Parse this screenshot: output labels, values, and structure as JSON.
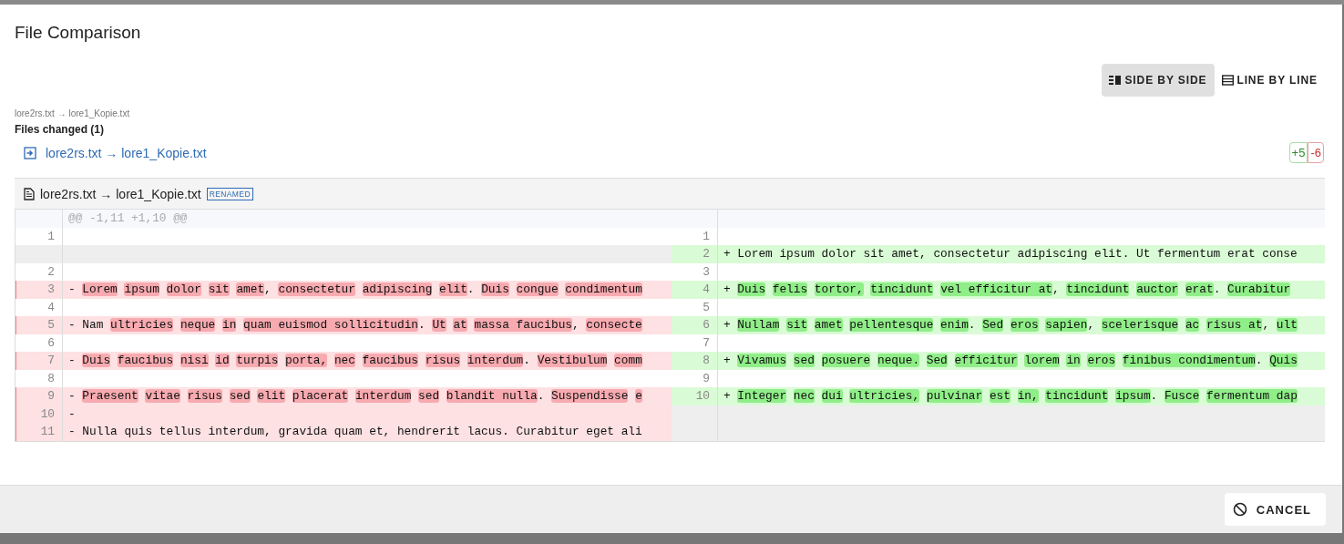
{
  "dialog": {
    "title": "File Comparison"
  },
  "view_modes": [
    {
      "label": "SIDE BY SIDE",
      "kind": "side",
      "selected": true
    },
    {
      "label": "LINE BY LINE",
      "kind": "line",
      "selected": false
    }
  ],
  "breadcrumb": "lore2rs.txt → lore1_Kopie.txt",
  "files_changed": {
    "heading": "Files changed (1)",
    "files": [
      {
        "name": "lore2rs.txt → lore1_Kopie.txt",
        "added": "+5",
        "removed": "-6"
      }
    ]
  },
  "file_header": {
    "name": "lore2rs.txt → lore1_Kopie.txt",
    "badge": "RENAMED"
  },
  "hunk": "@@ -1,11 +1,10 @@",
  "rows": [
    {
      "left": {
        "kind": "context",
        "number": "1"
      },
      "right": {
        "kind": "context",
        "number": "1"
      }
    },
    {
      "left": {
        "kind": "empty"
      },
      "right": {
        "kind": "insert",
        "number": "2",
        "sign": "+",
        "segments": [
          {
            "text": "Lorem ipsum dolor sit amet, consectetur adipiscing elit. Ut fermentum erat conse",
            "changed": false
          }
        ]
      }
    },
    {
      "left": {
        "kind": "context",
        "number": "2"
      },
      "right": {
        "kind": "context",
        "number": "3"
      }
    },
    {
      "left": {
        "kind": "delete",
        "number": "3",
        "sign": "-",
        "segments": [
          {
            "text": "Lorem",
            "changed": true
          },
          {
            "text": "ipsum",
            "changed": true
          },
          {
            "text": "dolor",
            "changed": true
          },
          {
            "text": "sit",
            "changed": true
          },
          {
            "text": "amet",
            "changed": true
          },
          {
            "text": ", ",
            "changed": false
          },
          {
            "text": "consectetur",
            "changed": true
          },
          {
            "text": "adipiscing",
            "changed": true
          },
          {
            "text": "elit",
            "changed": true
          },
          {
            "text": ". ",
            "changed": false
          },
          {
            "text": "Duis",
            "changed": true
          },
          {
            "text": "congue",
            "changed": true
          },
          {
            "text": "condimentum",
            "changed": true
          }
        ]
      },
      "right": {
        "kind": "insert",
        "number": "4",
        "sign": "+",
        "segments": [
          {
            "text": "Duis",
            "changed": true
          },
          {
            "text": "felis",
            "changed": true
          },
          {
            "text": "tortor,",
            "changed": true
          },
          {
            "text": "tincidunt",
            "changed": true
          },
          {
            "text": "vel efficitur at",
            "changed": true
          },
          {
            "text": ", ",
            "changed": false
          },
          {
            "text": "tincidunt",
            "changed": true
          },
          {
            "text": "auctor",
            "changed": true
          },
          {
            "text": "erat",
            "changed": true
          },
          {
            "text": ". ",
            "changed": false
          },
          {
            "text": "Curabitur",
            "changed": true
          }
        ]
      }
    },
    {
      "left": {
        "kind": "context",
        "number": "4"
      },
      "right": {
        "kind": "context",
        "number": "5"
      }
    },
    {
      "left": {
        "kind": "delete",
        "number": "5",
        "sign": "-",
        "segments": [
          {
            "text": "Nam ",
            "changed": false
          },
          {
            "text": "ultricies",
            "changed": true
          },
          {
            "text": "neque",
            "changed": true
          },
          {
            "text": "in",
            "changed": true
          },
          {
            "text": "quam euismod sollicitudin",
            "changed": true
          },
          {
            "text": ". ",
            "changed": false
          },
          {
            "text": "Ut",
            "changed": true
          },
          {
            "text": "at",
            "changed": true
          },
          {
            "text": "massa faucibus",
            "changed": true
          },
          {
            "text": ", ",
            "changed": false
          },
          {
            "text": "consecte",
            "changed": true
          }
        ]
      },
      "right": {
        "kind": "insert",
        "number": "6",
        "sign": "+",
        "segments": [
          {
            "text": "Nullam",
            "changed": true
          },
          {
            "text": "sit",
            "changed": true
          },
          {
            "text": "amet",
            "changed": true
          },
          {
            "text": "pellentesque",
            "changed": true
          },
          {
            "text": "enim",
            "changed": true
          },
          {
            "text": ". ",
            "changed": false
          },
          {
            "text": "Sed",
            "changed": true
          },
          {
            "text": "eros",
            "changed": true
          },
          {
            "text": "sapien",
            "changed": true
          },
          {
            "text": ", ",
            "changed": false
          },
          {
            "text": "scelerisque",
            "changed": true
          },
          {
            "text": "ac",
            "changed": true
          },
          {
            "text": "risus at",
            "changed": true
          },
          {
            "text": ", ",
            "changed": false
          },
          {
            "text": "ult",
            "changed": true
          }
        ]
      }
    },
    {
      "left": {
        "kind": "context",
        "number": "6"
      },
      "right": {
        "kind": "context",
        "number": "7"
      }
    },
    {
      "left": {
        "kind": "delete",
        "number": "7",
        "sign": "-",
        "segments": [
          {
            "text": "Duis",
            "changed": true
          },
          {
            "text": "faucibus",
            "changed": true
          },
          {
            "text": "nisi",
            "changed": true
          },
          {
            "text": "id",
            "changed": true
          },
          {
            "text": "turpis",
            "changed": true
          },
          {
            "text": "porta,",
            "changed": true
          },
          {
            "text": "nec",
            "changed": true
          },
          {
            "text": "faucibus",
            "changed": true
          },
          {
            "text": "risus",
            "changed": true
          },
          {
            "text": "interdum",
            "changed": true
          },
          {
            "text": ". ",
            "changed": false
          },
          {
            "text": "Vestibulum",
            "changed": true
          },
          {
            "text": "comm",
            "changed": true
          }
        ]
      },
      "right": {
        "kind": "insert",
        "number": "8",
        "sign": "+",
        "segments": [
          {
            "text": "Vivamus",
            "changed": true
          },
          {
            "text": "sed",
            "changed": true
          },
          {
            "text": "posuere",
            "changed": true
          },
          {
            "text": "neque.",
            "changed": true
          },
          {
            "text": "Sed",
            "changed": true
          },
          {
            "text": "efficitur",
            "changed": true
          },
          {
            "text": "lorem",
            "changed": true
          },
          {
            "text": "in",
            "changed": true
          },
          {
            "text": "eros",
            "changed": true
          },
          {
            "text": "finibus condimentum",
            "changed": true
          },
          {
            "text": ". ",
            "changed": false
          },
          {
            "text": "Quis",
            "changed": true
          }
        ]
      }
    },
    {
      "left": {
        "kind": "context",
        "number": "8"
      },
      "right": {
        "kind": "context",
        "number": "9"
      }
    },
    {
      "left": {
        "kind": "delete",
        "number": "9",
        "sign": "-",
        "segments": [
          {
            "text": "Praesent",
            "changed": true
          },
          {
            "text": "vitae",
            "changed": true
          },
          {
            "text": "risus",
            "changed": true
          },
          {
            "text": "sed",
            "changed": true
          },
          {
            "text": "elit",
            "changed": true
          },
          {
            "text": "placerat",
            "changed": true
          },
          {
            "text": "interdum",
            "changed": true
          },
          {
            "text": "sed",
            "changed": true
          },
          {
            "text": "blandit nulla",
            "changed": true
          },
          {
            "text": ". ",
            "changed": false
          },
          {
            "text": "Suspendisse",
            "changed": true
          },
          {
            "text": "e",
            "changed": true
          }
        ]
      },
      "right": {
        "kind": "insert",
        "number": "10",
        "sign": "+",
        "segments": [
          {
            "text": "Integer",
            "changed": true
          },
          {
            "text": "nec",
            "changed": true
          },
          {
            "text": "dui",
            "changed": true
          },
          {
            "text": "ultricies,",
            "changed": true
          },
          {
            "text": "pulvinar",
            "changed": true
          },
          {
            "text": "est",
            "changed": true
          },
          {
            "text": "in,",
            "changed": true
          },
          {
            "text": "tincidunt",
            "changed": true
          },
          {
            "text": "ipsum",
            "changed": true
          },
          {
            "text": ". ",
            "changed": false
          },
          {
            "text": "Fusce",
            "changed": true
          },
          {
            "text": "fermentum dap",
            "changed": true
          }
        ]
      }
    },
    {
      "left": {
        "kind": "delete",
        "number": "10",
        "sign": "-"
      },
      "right": {
        "kind": "empty"
      }
    },
    {
      "left": {
        "kind": "delete",
        "number": "11",
        "sign": "-",
        "segments": [
          {
            "text": "Nulla quis tellus interdum, gravida quam et, hendrerit lacus. Curabitur eget ali",
            "changed": false
          }
        ]
      },
      "right": {
        "kind": "empty"
      }
    }
  ],
  "footer": {
    "cancel": "CANCEL"
  }
}
